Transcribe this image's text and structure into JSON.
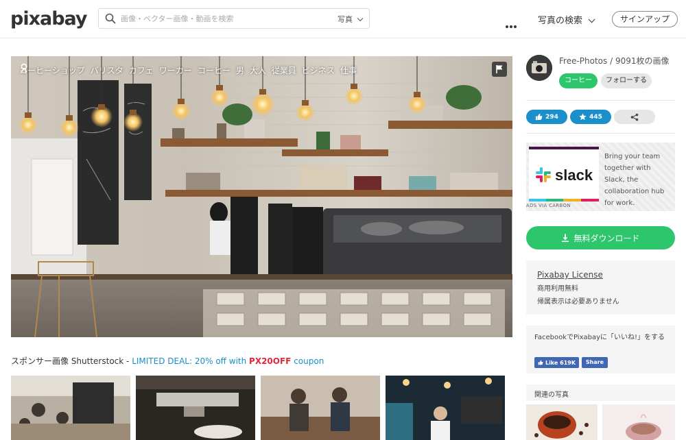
{
  "header": {
    "logo": "pixabay",
    "search_placeholder": "画像・ベクター画像・動画を検索",
    "search_type": "写真",
    "explore_label": "写真の検索",
    "signup_label": "サインアップ"
  },
  "photo": {
    "tags": [
      "コーヒーショップ",
      "バリスタ",
      "カフェ",
      "ワーカー",
      "コーヒー",
      "男",
      "大人",
      "従業員",
      "ビジネス",
      "仕事"
    ]
  },
  "sponsor": {
    "prefix": "スポンサー画像 Shutterstock - ",
    "deal": "LIMITED DEAL: 20% off with ",
    "code": "PX20OFF",
    "suffix": " coupon"
  },
  "user": {
    "info": "Free-Photos / 9091枚の画像",
    "coffee_label": "コーヒー",
    "follow_label": "フォローする"
  },
  "stats": {
    "likes": "294",
    "favorites": "445"
  },
  "ad": {
    "brand": "slack",
    "text": "Bring your team together with Slack, the collaboration hub for work.",
    "via": "ADS VIA CARBON"
  },
  "download_label": "無料ダウンロード",
  "license": {
    "title": "Pixabay License",
    "line1": "商用利用無料",
    "line2": "帰属表示は必要ありません"
  },
  "facebook": {
    "text": "FacebookでPixabayに「いいね!」をする",
    "like_label": "Like 619K",
    "share_label": "Share"
  },
  "related_title": "関連の写真",
  "colors": {
    "green": "#2ec66d",
    "blue": "#1a8fc9",
    "red": "#e0293c",
    "facebook": "#4267b2"
  }
}
